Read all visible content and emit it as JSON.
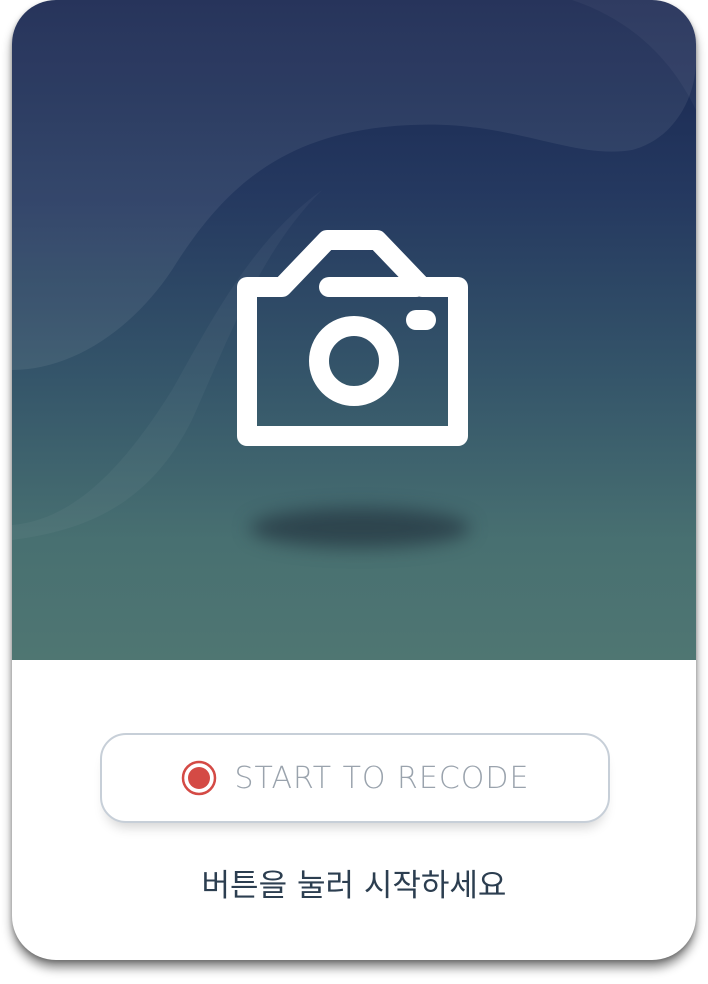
{
  "hero": {
    "icon": "camera-icon",
    "colors": {
      "gradient_top": "#17254f",
      "gradient_bottom": "#4f7672",
      "icon": "#ffffff"
    }
  },
  "record": {
    "icon": "record-icon",
    "label": "START TO RECODE",
    "accent_color": "#d44a45"
  },
  "hint": {
    "text": "버튼을 눌러 시작하세요"
  }
}
